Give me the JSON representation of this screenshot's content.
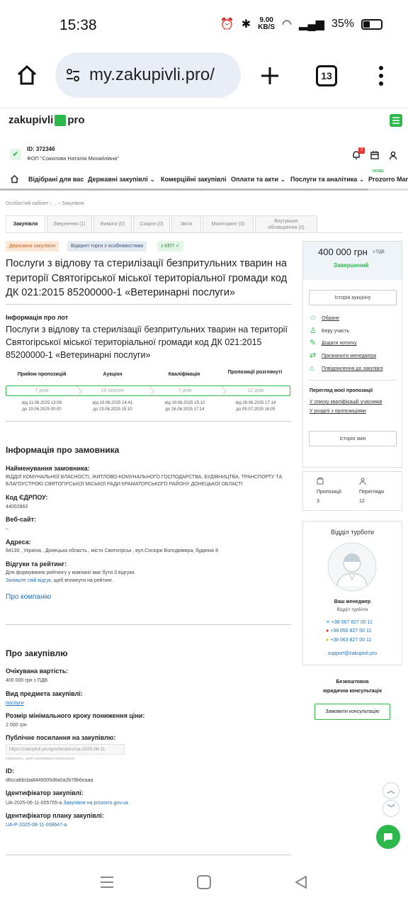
{
  "status": {
    "time": "15:38",
    "net_speed": "9.00\nKB/S",
    "battery": "35%"
  },
  "browser": {
    "url": "my.zakupivli.pro/",
    "tab_count": "13"
  },
  "site": {
    "logo_left": "zakupivli",
    "logo_right": "pro",
    "user_id": "ID: 372346",
    "user_name": "ФОП \"Соколова Наталія Михайлівна\"",
    "notif_count": "3",
    "nav": [
      "Відібрані для вас",
      "Державні закупівлі",
      "Комерційні закупівлі",
      "Оплати та акти",
      "Послуги та аналітика",
      "Prozorro Marke"
    ],
    "nav_new": "НОВЕ",
    "breadcrumb": "Особистий кабінет  ›  ...  ›  Закупівля",
    "tabs": [
      "Закупівля",
      "Звернення (1)",
      "Вимоги (0)",
      "Скарги (0)",
      "Звіти",
      "Моніторинг (0)",
      "Внутрішнє обговорення (0)"
    ],
    "tags": [
      "Державна закупівля",
      "Відкриті торги з особливостями",
      "з КЕП"
    ],
    "title": "Послуги з відлову та стерилізації безпритульних тварин на території Святогірської міської територіальної громади код ДК 021:2015 85200000-1 «Ветеринарні послуги»",
    "lot_label": "Інформація про лот",
    "lot_title": "Послуги з відлову та стерилізації безпритульних тварин на території Святогірської міської територіальної громади код ДК 021:2015 85200000-1 «Ветеринарні послуги»",
    "steps": [
      {
        "head": "Прийом пропозицій",
        "value": "7 днів",
        "dates": "від 11.06.2025 13:08\nдо 19.06.2025 00:00"
      },
      {
        "head": "Аукціон",
        "value": "29 хвилин",
        "dates": "від 19.06.2025 14:41\nдо 19.06.2025 15:10"
      },
      {
        "head": "Кваліфікація",
        "value": "7 днів",
        "dates": "від 19.06.2025 15:10\nдо 26.06.2025 17:14"
      },
      {
        "head": "Пропозиції розглянуті",
        "value": "12 днів",
        "dates": "від 26.06.2025 17:14\nдо 09.07.2025 16:05"
      }
    ],
    "customer": {
      "heading": "Інформація про замовника",
      "name_label": "Найменування замовника:",
      "name_value": "ВІДДІЛ КОМУНАЛЬНОЇ ВЛАСНОСТІ, ЖИТЛОВО-КОМУНАЛЬНОГО ГОСПОДАРСТВА, БУДІВНИЦТВА, ТРАНСПОРТУ ТА БЛАГОУСТРОЮ СВЯТОГІРСЬКОЇ МІСЬКОЇ РАДИ КРАМАТОРСЬКОГО РАЙОНУ ДОНЕЦЬКОЇ ОБЛАСТІ",
      "code_label": "Код ЄДРПОУ:",
      "code_value": "44002863",
      "web_label": "Веб-сайт:",
      "web_value": "–",
      "addr_label": "Адреса:",
      "addr_value": "84130 , Україна , Донецька область , місто Святогірськ , вул.Сосюри Володимира, будинок 8",
      "reviews_label": "Відгуки та рейтинг:",
      "reviews_text": "Для формування рейтингу у компанії має бути 3 відгуки.",
      "reviews_link": "Залиште свій відгук",
      "reviews_tail": ", щоб вплинути на рейтинг.",
      "about_link": "Про компанію"
    },
    "purchase": {
      "heading": "Про закупівлю",
      "cost_label": "Очікувана вартість:",
      "cost_value": "400 000 грн з ПДВ",
      "subject_label": "Вид предмета закупівлі:",
      "subject_value": "послуги",
      "step_label": "Розмір мінімального кроку пониження ціни:",
      "step_value": "2 000 грн",
      "public_label": "Публічне посилання на закупівлю:",
      "public_value": "https://zakupivli.pro/gov/tenders/ua-2025-06-11",
      "public_hint": "Натисніть, щоб скопіювати посилання",
      "id_label": "ID:",
      "id_value": "d6ccabbcba8449005d8a0a2b78b6eaaa",
      "ident_label": "Ідентифікатор закупівлі:",
      "ident_value": "UA-2025-06-11-005755-a",
      "ident_link": "Закупівля на prozorro.gov.ua",
      "plan_label": "Ідентифікатор плану закупівлі:",
      "plan_value": "UA-P-2025-06-11-008647-a"
    },
    "side": {
      "price": "400 000 грн",
      "price_vat": "з ПДВ",
      "state": "Завершений",
      "auction_history": "Історія аукціону",
      "actions": [
        "Обране",
        "Беру участь",
        "Додати нотатку",
        "Призначити менеджера",
        "Повідомлення до закупівлі"
      ],
      "offers_heading": "Перегляд моєї пропозиції",
      "offers_links": [
        "У списку кваліфікацій учасників",
        "У розділі з пропозиціями"
      ],
      "changes_history": "Історія змін",
      "stat_offers_label": "Пропозиції",
      "stat_offers_value": "3",
      "stat_views_label": "Перегляди",
      "stat_views_value": "12",
      "care_heading": "Відділ турботи",
      "manager_title": "Ваш менеджер",
      "manager_sub": "Відділ турботи",
      "phones": [
        "+38 067 827 00 11",
        "+38 050 827 00 11",
        "+38 063 827 00 11"
      ],
      "email": "support@zakupivli.pro",
      "consult_line1": "Безкоштовна",
      "consult_line2": "юридична консультація",
      "consult_btn": "Замовити консультацію"
    }
  },
  "colors": {
    "accent": "#2db84b",
    "link": "#1d6fb8"
  }
}
